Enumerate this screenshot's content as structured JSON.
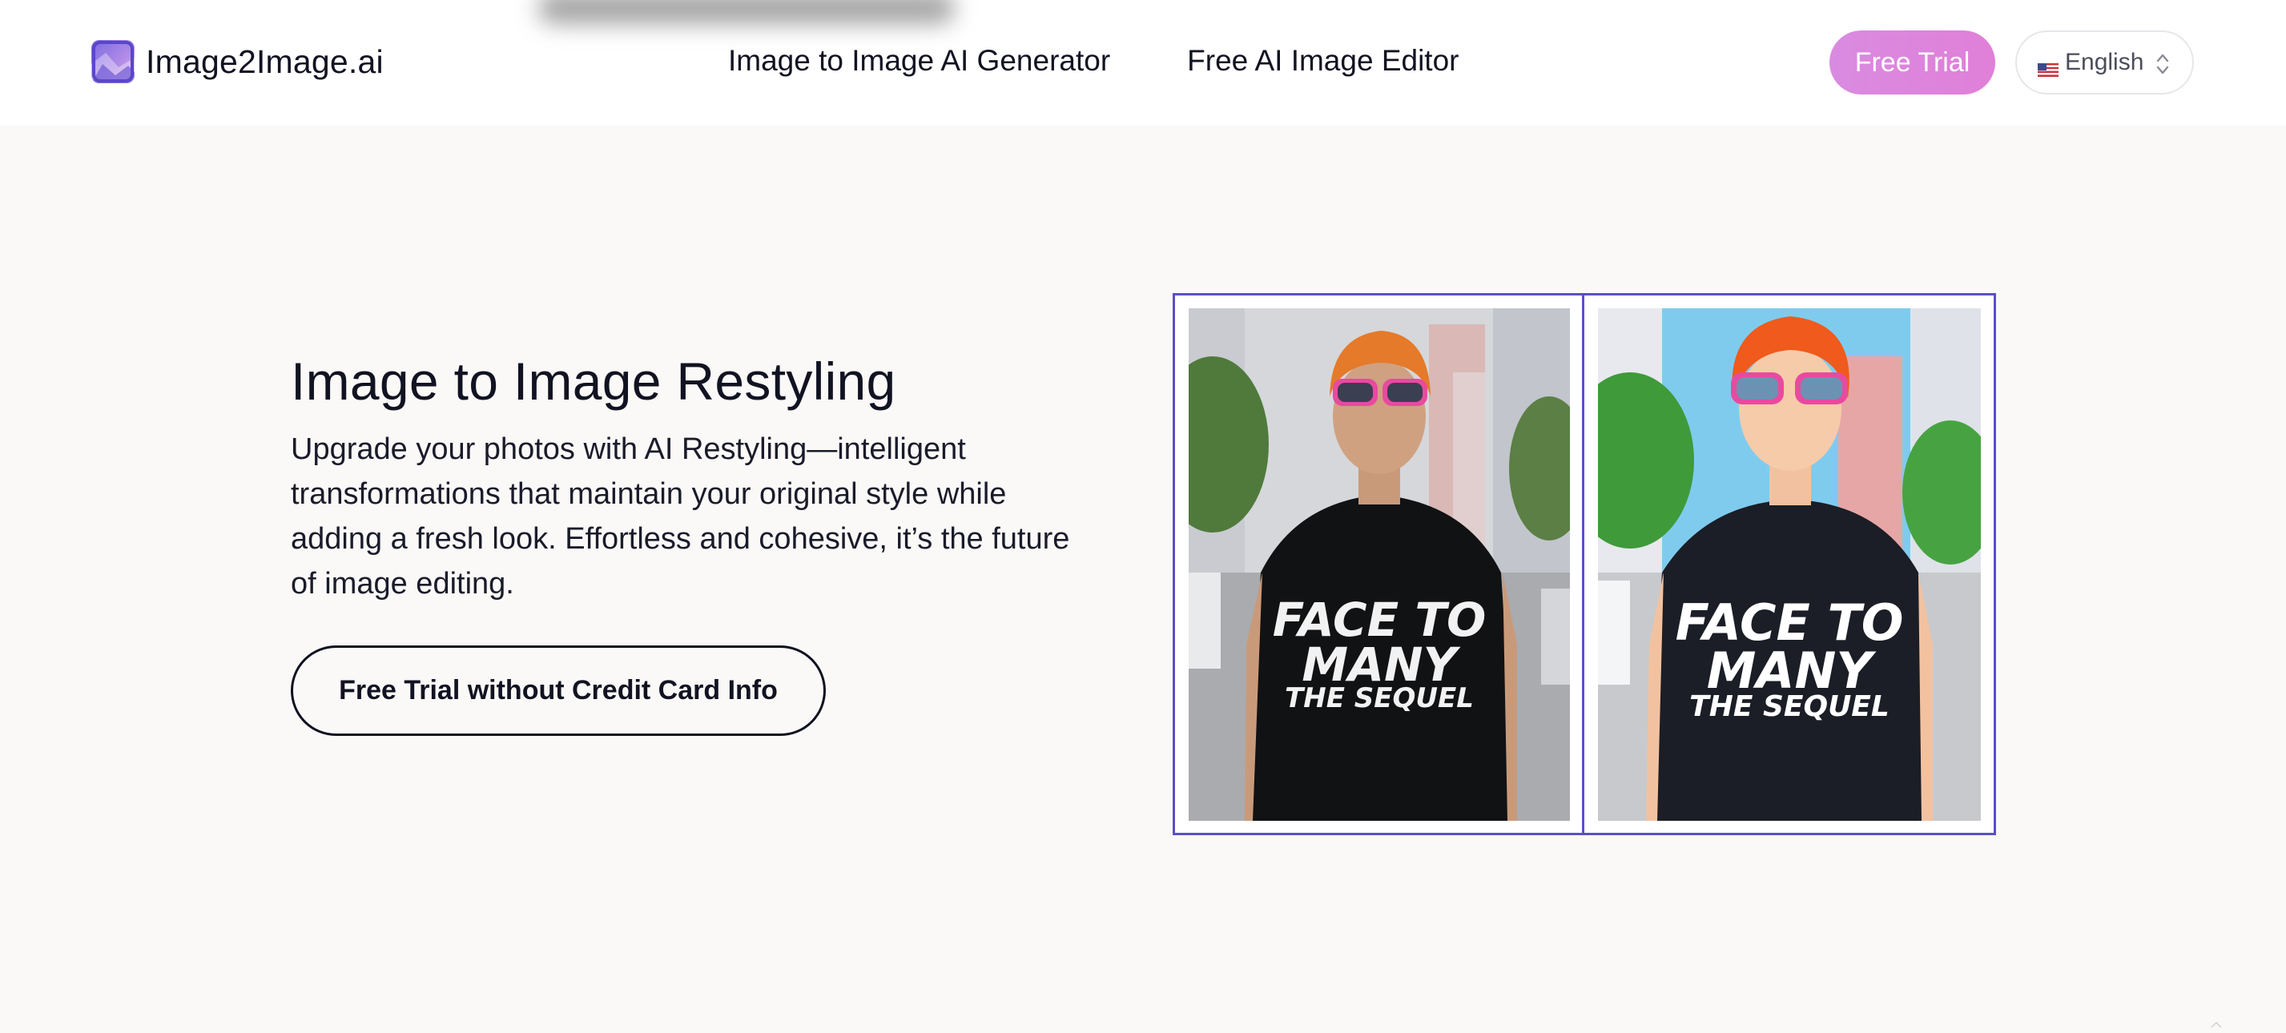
{
  "header": {
    "brand_name": "Image2Image.ai",
    "brand_logo_icon": "image-icon",
    "nav": [
      {
        "label": "Image to Image AI Generator"
      },
      {
        "label": "Free AI Image Editor"
      }
    ],
    "trial_button": "Free Trial",
    "language": {
      "flag_icon": "us-flag-icon",
      "label": "English",
      "chevron_icon": "sort-chevrons-icon"
    }
  },
  "hero": {
    "title": "Image to Image Restyling",
    "description": "Upgrade your photos with AI Restyling—intelligent transformations that maintain your original style while adding a fresh look. Effortless and cohesive, it’s the future of image editing.",
    "cta": "Free Trial without Credit Card Info"
  },
  "comparison": {
    "original_shirt_lines": [
      "FACE TO",
      "MANY",
      "THE SEQUEL"
    ],
    "restyled_shirt_lines": [
      "FACE TO",
      "MANY",
      "THE SEQUEL"
    ]
  },
  "colors": {
    "accent_gradient_start": "#d98be0",
    "frame": "#5b4fc4",
    "background": "#faf9f7"
  }
}
